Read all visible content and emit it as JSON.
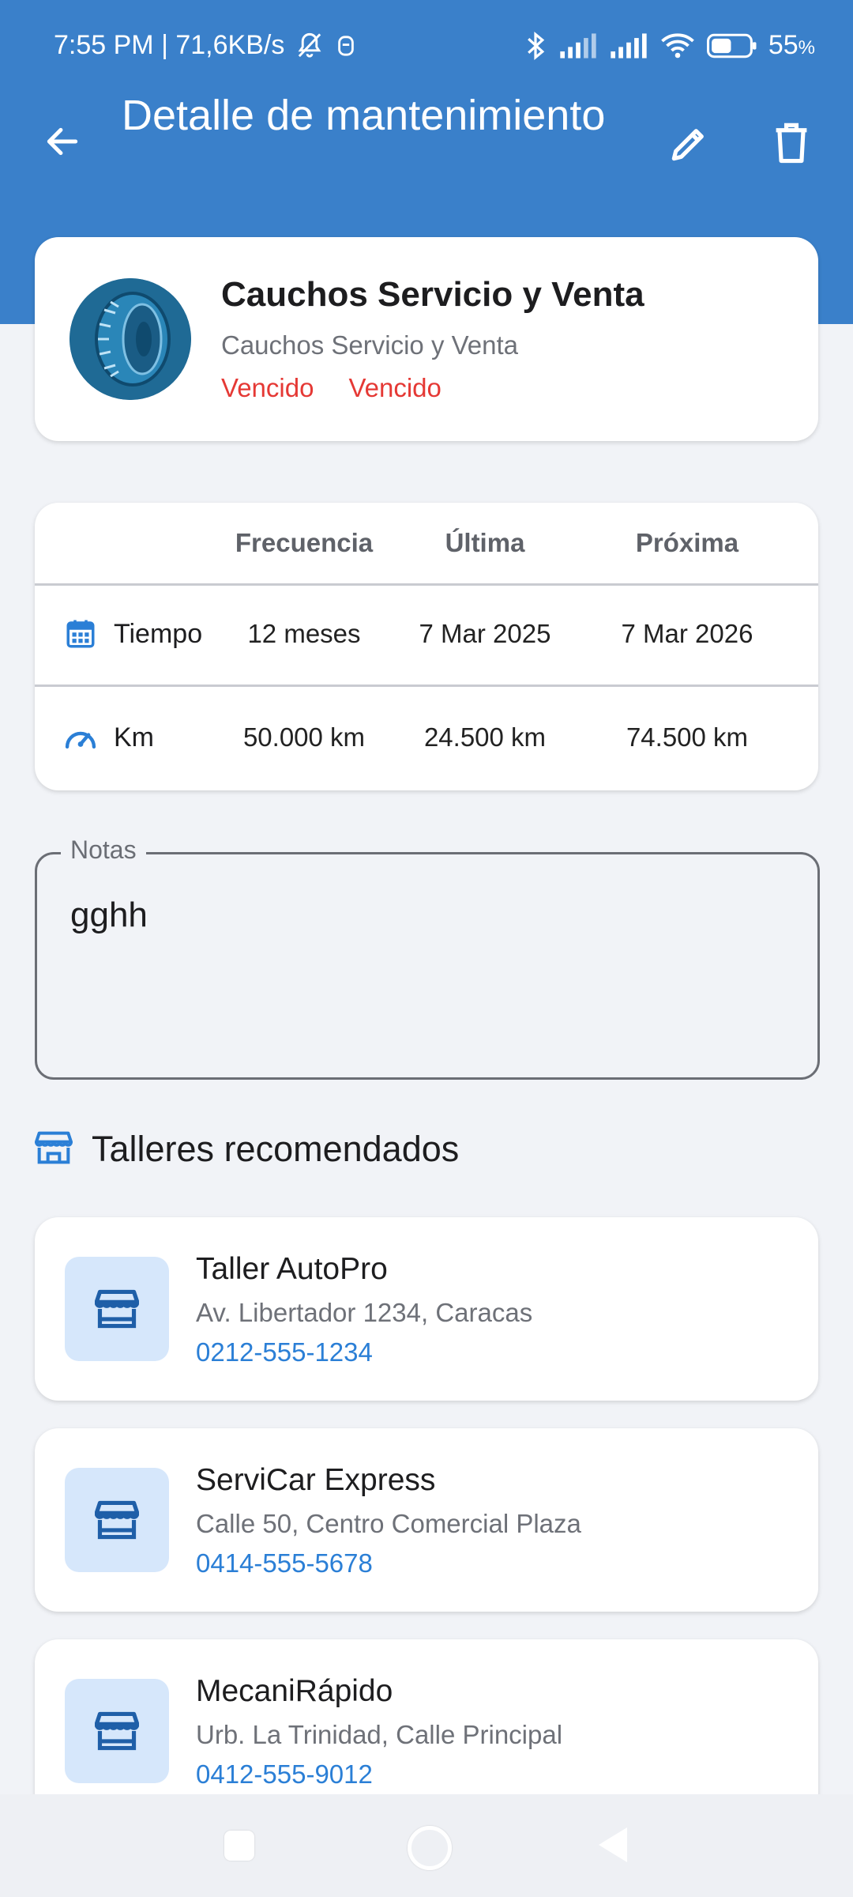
{
  "status_bar": {
    "time_net": "7:55 PM | 71,6KB/s",
    "battery": "55",
    "battery_unit": "%"
  },
  "app_bar": {
    "title": "Detalle de mantenimiento"
  },
  "summary": {
    "title": "Cauchos Servicio y Venta",
    "subtitle": "Cauchos Servicio y Venta",
    "status_1": "Vencido",
    "status_2": "Vencido",
    "status_color": "#e53935"
  },
  "schedule": {
    "headers": [
      "",
      "Frecuencia",
      "Última",
      "Próxima"
    ],
    "rows": [
      {
        "icon": "calendar-icon",
        "label": "Tiempo",
        "frecuencia": "12 meses",
        "ultima": "7 Mar 2025",
        "proxima": "7 Mar 2026"
      },
      {
        "icon": "speedometer-icon",
        "label": "Km",
        "frecuencia": "50.000 km",
        "ultima": "24.500 km",
        "proxima": "74.500 km"
      }
    ]
  },
  "notes": {
    "label": "Notas",
    "value": "gghh"
  },
  "workshops": {
    "title": "Talleres recomendados",
    "items": [
      {
        "name": "Taller AutoPro",
        "address": "Av. Libertador 1234, Caracas",
        "phone": "0212-555-1234"
      },
      {
        "name": "ServiCar Express",
        "address": "Calle 50, Centro Comercial Plaza",
        "phone": "0414-555-5678"
      },
      {
        "name": "MecaniRápido",
        "address": "Urb. La Trinidad, Calle Principal",
        "phone": "0412-555-9012"
      }
    ]
  },
  "colors": {
    "primary": "#3a80ca",
    "accent_icon": "#2b7fd6",
    "link": "#2b7fd6",
    "shop_icon_bg": "#d6e7fb"
  }
}
